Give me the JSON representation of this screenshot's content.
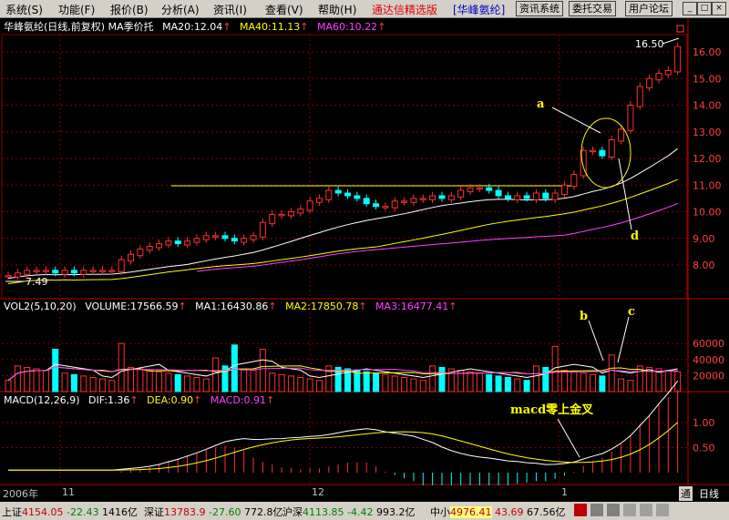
{
  "menubar": {
    "items": [
      "系统(S)",
      "功能(F)",
      "报价(B)",
      "分析(A)",
      "资讯(I)",
      "查看(V)",
      "帮助(H)"
    ],
    "brand": "通达信精选版",
    "stock_tag": "[华峰氨纶]",
    "buttons": [
      "资讯系统",
      "委托交易",
      "用户论坛"
    ],
    "win_buttons": [
      "_",
      "□",
      "×"
    ]
  },
  "main_chart": {
    "title": "华峰氨纶(日线,前复权) MA季价托",
    "ma20": "MA20:12.04",
    "ma40": "MA40:11.13",
    "ma60": "MA60:10.22",
    "high_label": "16.50",
    "low_label": "7.49",
    "annotations": {
      "a": "a",
      "d": "d"
    },
    "y_ticks": [
      "16.00",
      "15.00",
      "14.00",
      "13.00",
      "12.00",
      "11.00",
      "10.00",
      "9.00",
      "8.00"
    ]
  },
  "volume_chart": {
    "title": "VOL2(5,10,20)",
    "volume": "VOLUME:17566.59",
    "ma1": "MA1:16430.86",
    "ma2": "MA2:17850.78",
    "ma3": "MA3:16477.41",
    "annotations": {
      "b": "b",
      "c": "c"
    },
    "y_ticks": [
      "60000",
      "40000",
      "20000"
    ]
  },
  "macd_chart": {
    "title": "MACD(12,26,9)",
    "dif": "DIF:1.36",
    "dea": "DEA:0.90",
    "macd": "MACD:0.91",
    "annotation": "macd零上金叉",
    "y_ticks": [
      "1.00",
      "0.50"
    ]
  },
  "time_axis": {
    "labels": [
      "2006年",
      "11",
      "12",
      "1"
    ]
  },
  "bottom_tabs": {
    "tab1": "通",
    "tab2": "日线"
  },
  "status_bar": {
    "sh_name": "上证",
    "sh_value": "4154.05",
    "sh_change": "-22.43",
    "sh_amount": "1416亿",
    "sz_name": "深证",
    "sz_value": "13783.9",
    "sz_change": "-27.60",
    "sz_amount": "772.8亿",
    "hs_name": "沪深",
    "hs_value": "4113.85",
    "hs_change": "-4.42",
    "hs_amount": "993.2亿",
    "zx_name": "中小",
    "zx_value": "4976.41",
    "zx_change": "43.69",
    "zx_amount": "67.56亿"
  },
  "colors": {
    "up": "#ff3030",
    "down": "#00ffff",
    "ma20": "#ffffff",
    "ma40": "#ffff00",
    "ma60": "#ff40ff",
    "grid": "#800000"
  },
  "icons": {
    "arrow": "up-arrow-icon"
  }
}
